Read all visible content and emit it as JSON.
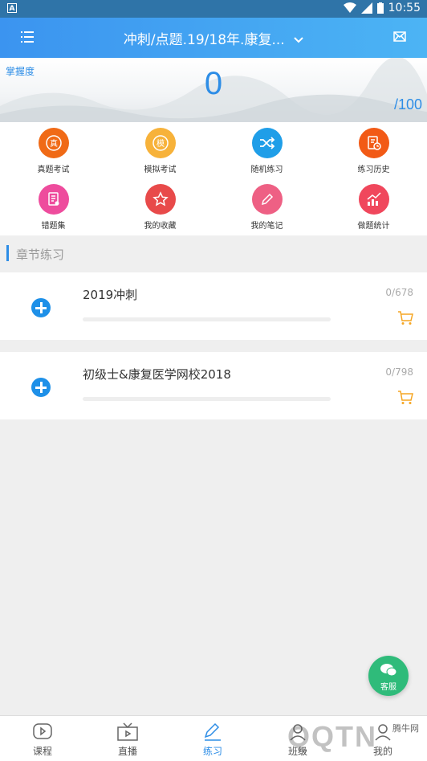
{
  "status_bar": {
    "time": "10:55"
  },
  "header": {
    "title": "冲刺/点题.19/18年.康复..."
  },
  "mastery": {
    "label": "掌握度",
    "score": "0",
    "total": "/100"
  },
  "grid": [
    {
      "label": "真题考试",
      "color": "#f06a16",
      "glyph": "真"
    },
    {
      "label": "模拟考试",
      "color": "#f7b23a",
      "glyph": "模"
    },
    {
      "label": "随机练习",
      "color": "#1f9ee8",
      "glyph": ""
    },
    {
      "label": "练习历史",
      "color": "#f25a16",
      "glyph": ""
    },
    {
      "label": "错题集",
      "color": "#ee4c9d",
      "glyph": ""
    },
    {
      "label": "我的收藏",
      "color": "#e84a4a",
      "glyph": ""
    },
    {
      "label": "我的笔记",
      "color": "#ee6084",
      "glyph": ""
    },
    {
      "label": "做题统计",
      "color": "#f0475c",
      "glyph": ""
    }
  ],
  "section": {
    "title": "章节练习"
  },
  "chapters": [
    {
      "name": "2019冲刺",
      "count": "0/678",
      "progress": 0
    },
    {
      "name": "初级士&康复医学网校2018",
      "count": "0/798",
      "progress": 0
    }
  ],
  "fab": {
    "label": "客服"
  },
  "tabs": [
    {
      "label": "课程"
    },
    {
      "label": "直播"
    },
    {
      "label": "练习",
      "active": true
    },
    {
      "label": "班级"
    },
    {
      "label": "我的"
    }
  ],
  "watermark": {
    "text": "QQTN",
    "sub": "腾牛网"
  }
}
